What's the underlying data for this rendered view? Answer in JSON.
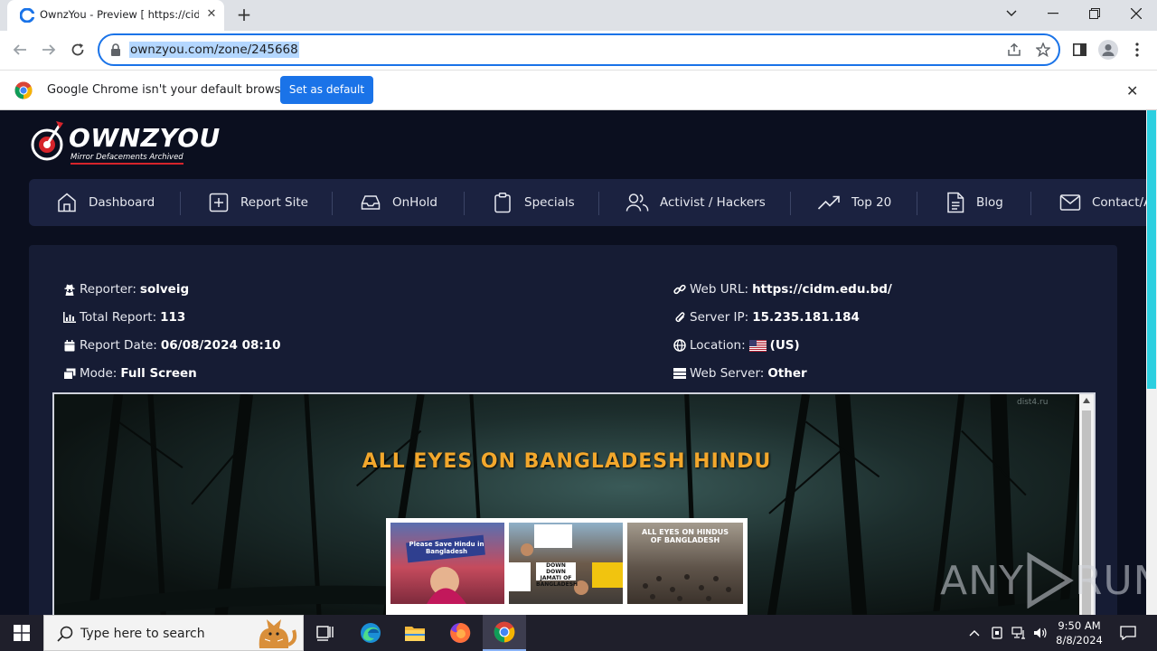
{
  "browser": {
    "tab_title": "OwnzYou - Preview [ https://cidm",
    "url": "ownzyou.com/zone/245668",
    "infobar_message": "Google Chrome isn't your default browser",
    "infobar_button": "Set as default"
  },
  "site": {
    "logo_word": "OWNZYOU",
    "logo_tagline": "Mirror Defacements Archived",
    "nav": [
      {
        "label": "Dashboard",
        "icon": "home-icon"
      },
      {
        "label": "Report Site",
        "icon": "plus-square-icon"
      },
      {
        "label": "OnHold",
        "icon": "inbox-icon"
      },
      {
        "label": "Specials",
        "icon": "clipboard-icon"
      },
      {
        "label": "Activist / Hackers",
        "icon": "users-icon"
      },
      {
        "label": "Top 20",
        "icon": "trending-up-icon"
      },
      {
        "label": "Blog",
        "icon": "document-icon"
      },
      {
        "label": "Contact/A",
        "icon": "mail-icon"
      }
    ]
  },
  "report": {
    "reporter_label": "Reporter:",
    "reporter": "solveig",
    "total_label": "Total Report:",
    "total": "113",
    "date_label": "Report Date:",
    "date": "06/08/2024 08:10",
    "mode_label": "Mode:",
    "mode": "Full Screen",
    "weburl_label": "Web URL:",
    "weburl": "https://cidm.edu.bd/",
    "ip_label": "Server IP:",
    "ip": "15.235.181.184",
    "location_label": "Location:",
    "location": "(US)",
    "webserver_label": "Web Server:",
    "webserver": "Other"
  },
  "mirror": {
    "headline": "ALL EYES ON BANGLADESH HINDU",
    "corner_mark": "dist4.ru",
    "photo_captions": [
      "Please Save Hindu in Bangladesh",
      "DOWN DOWN JAMATI OF BANGLADESH",
      "ALL EYES ON HINDUS OF BANGLADESH"
    ]
  },
  "watermark": {
    "left": "ANY",
    "right": "RUN"
  },
  "taskbar": {
    "search_placeholder": "Type here to search",
    "time": "9:50 AM",
    "date": "8/8/2024"
  },
  "colors": {
    "accent_blue": "#1a73e8",
    "page_bg": "#0b0f1f",
    "nav_bg": "#1b2240",
    "headline": "#f2a72c",
    "scroll_accent": "#2ccfe0"
  }
}
